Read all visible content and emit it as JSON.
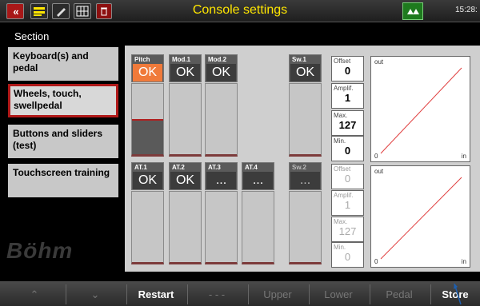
{
  "header": {
    "title": "Console settings",
    "back_label": "«",
    "clock": "15:28:",
    "icons": [
      "back-icon",
      "registration-icon",
      "edit-icon",
      "keyboard-grid-icon",
      "trash-icon",
      "transposer-icon"
    ],
    "icon_texts": [
      "",
      "",
      "",
      "",
      "",
      ""
    ]
  },
  "section_label": "Section",
  "sidebar": {
    "items": [
      {
        "label": "Keyboard(s) and pedal",
        "active": false
      },
      {
        "label": "Wheels, touch, swellpedal",
        "active": true
      },
      {
        "label": "Buttons and sliders (test)",
        "active": false
      },
      {
        "label": "Touchscreen training",
        "active": false
      }
    ]
  },
  "logo": "Böhm",
  "top_channels": [
    {
      "name": "Pitch",
      "value": "OK",
      "highlight": true,
      "level": 0.5
    },
    {
      "name": "Mod.1",
      "value": "OK",
      "highlight": false,
      "level": 0
    },
    {
      "name": "Mod.2",
      "value": "OK",
      "highlight": false,
      "level": 0
    },
    {
      "name": "Sw.1",
      "value": "OK",
      "highlight": false,
      "level": 0
    }
  ],
  "bottom_channels": [
    {
      "name": "AT.1",
      "value": "OK",
      "dim": false
    },
    {
      "name": "AT.2",
      "value": "OK",
      "dim": false
    },
    {
      "name": "AT.3",
      "value": "...",
      "dim": false
    },
    {
      "name": "AT.4",
      "value": "...",
      "dim": false
    },
    {
      "name": "Sw.2",
      "value": "...",
      "dim": true
    }
  ],
  "top_params": [
    {
      "label": "Offset",
      "value": "0"
    },
    {
      "label": "Amplif.",
      "value": "1"
    },
    {
      "label": "Max.",
      "value": "127"
    },
    {
      "label": "Min.",
      "value": "0"
    }
  ],
  "bottom_params": [
    {
      "label": "Offset",
      "value": "0"
    },
    {
      "label": "Amplif.",
      "value": "1"
    },
    {
      "label": "Max.",
      "value": "127"
    },
    {
      "label": "Min.",
      "value": "0"
    }
  ],
  "graph": {
    "out_label": "out",
    "in_label": "in",
    "zero_label": "0",
    "line_color": "#e04040"
  },
  "bottom_bar": [
    {
      "label": "⌃",
      "dim": true,
      "icon": "chevron-up-icon"
    },
    {
      "label": "⌄",
      "dim": true,
      "icon": "chevron-down-icon"
    },
    {
      "label": "Restart",
      "dim": false
    },
    {
      "label": "- - -",
      "dim": true
    },
    {
      "label": "Upper",
      "dim": true
    },
    {
      "label": "Lower",
      "dim": true
    },
    {
      "label": "Pedal",
      "dim": true
    },
    {
      "label": "Store",
      "dim": false
    }
  ]
}
